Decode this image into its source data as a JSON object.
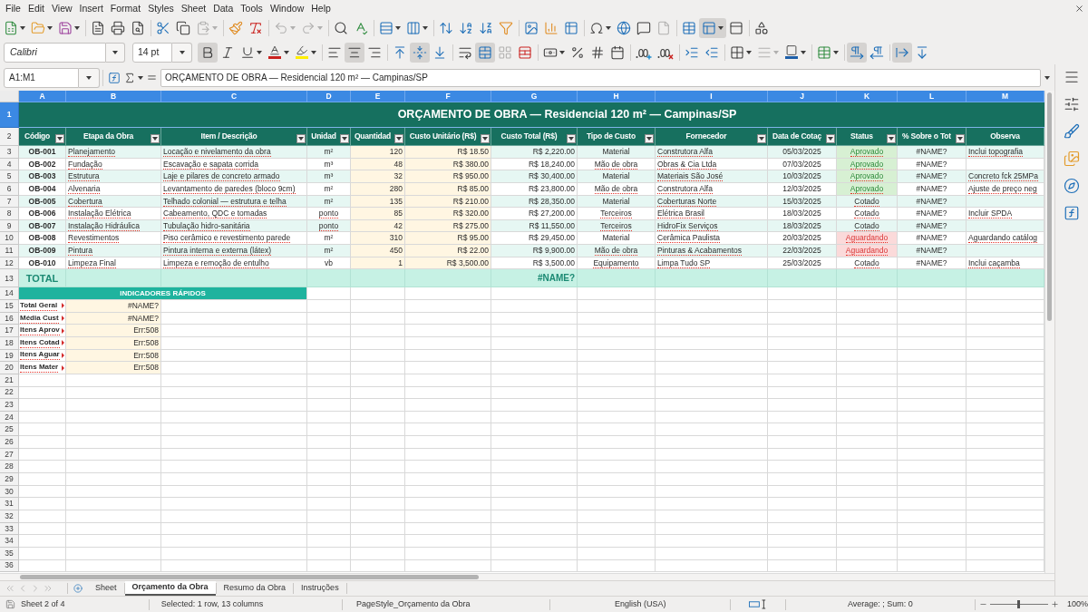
{
  "menu_bar": {
    "items": [
      "File",
      "Edit",
      "View",
      "Insert",
      "Format",
      "Styles",
      "Sheet",
      "Data",
      "Tools",
      "Window",
      "Help"
    ]
  },
  "standard_toolbar": {
    "paste_disabled": true,
    "undo_disabled": true,
    "redo_disabled": true,
    "headers_footers_disabled": true,
    "freeze_pressed": true
  },
  "formatting_toolbar": {
    "font_name": "Calibri",
    "font_size": "14 pt",
    "bold": true,
    "italic": false,
    "underline": false,
    "align_left": false,
    "align_center": true,
    "align_right": false,
    "align_top": false,
    "align_middle": true,
    "align_bottom": false,
    "merge_center": true,
    "merge_cells_disabled": true,
    "border_style_disabled": true,
    "paragraph_ltr": true,
    "paragraph_rtl": false,
    "text_horizontal": true,
    "text_vertical": false
  },
  "formula_bar": {
    "name_box": "A1:M1",
    "formula": "ORÇAMENTO DE OBRA — Residencial 120 m² — Campinas/SP"
  },
  "sheet": {
    "column_headers": [
      {
        "label": "A",
        "selected": true
      },
      {
        "label": "B",
        "selected": true
      },
      {
        "label": "C",
        "selected": true
      },
      {
        "label": "D",
        "selected": true
      },
      {
        "label": "E",
        "selected": true
      },
      {
        "label": "F",
        "selected": true
      },
      {
        "label": "G",
        "selected": true
      },
      {
        "label": "H",
        "selected": true
      },
      {
        "label": "I",
        "selected": true
      },
      {
        "label": "J",
        "selected": true
      },
      {
        "label": "K",
        "selected": true
      },
      {
        "label": "L",
        "selected": true
      },
      {
        "label": "M",
        "selected": true
      }
    ],
    "row_headers": [
      {
        "label": "1",
        "selected": true
      },
      {
        "label": "2",
        "selected": false
      },
      {
        "label": "3",
        "selected": false
      },
      {
        "label": "4",
        "selected": false
      },
      {
        "label": "5",
        "selected": false
      },
      {
        "label": "6",
        "selected": false
      },
      {
        "label": "7",
        "selected": false
      },
      {
        "label": "8",
        "selected": false
      },
      {
        "label": "9",
        "selected": false
      },
      {
        "label": "10",
        "selected": false
      },
      {
        "label": "11",
        "selected": false
      },
      {
        "label": "12",
        "selected": false
      },
      {
        "label": "13",
        "selected": false
      },
      {
        "label": "14",
        "selected": false
      },
      {
        "label": "15",
        "selected": false
      },
      {
        "label": "16",
        "selected": false
      },
      {
        "label": "17",
        "selected": false
      },
      {
        "label": "18",
        "selected": false
      },
      {
        "label": "19",
        "selected": false
      },
      {
        "label": "20",
        "selected": false
      },
      {
        "label": "21",
        "selected": false
      },
      {
        "label": "22",
        "selected": false
      },
      {
        "label": "23",
        "selected": false
      },
      {
        "label": "24",
        "selected": false
      },
      {
        "label": "25",
        "selected": false
      },
      {
        "label": "26",
        "selected": false
      },
      {
        "label": "27",
        "selected": false
      },
      {
        "label": "28",
        "selected": false
      },
      {
        "label": "29",
        "selected": false
      },
      {
        "label": "30",
        "selected": false
      },
      {
        "label": "31",
        "selected": false
      },
      {
        "label": "32",
        "selected": false
      },
      {
        "label": "33",
        "selected": false
      },
      {
        "label": "34",
        "selected": false
      },
      {
        "label": "35",
        "selected": false
      },
      {
        "label": "36",
        "selected": false
      }
    ],
    "title": "ORÇAMENTO DE OBRA — Residencial 120 m² — Campinas/SP",
    "columns": [
      {
        "label": "Código",
        "filter": true
      },
      {
        "label": "Etapa da Obra",
        "filter": true
      },
      {
        "label": "Item / Descrição",
        "filter": true
      },
      {
        "label": "Unidad",
        "filter": true
      },
      {
        "label": "Quantidad",
        "filter": true
      },
      {
        "label": "Custo Unitário (R$)",
        "filter": true
      },
      {
        "label": "Custo Total (R$)",
        "filter": true
      },
      {
        "label": "Tipo de Custo",
        "filter": true
      },
      {
        "label": "Fornecedor",
        "filter": true
      },
      {
        "label": "Data de Cotaç",
        "filter": true
      },
      {
        "label": "Status",
        "filter": true
      },
      {
        "label": "% Sobre o Tot",
        "filter": true
      },
      {
        "label": "Observa",
        "filter": false
      }
    ],
    "rows": [
      {
        "cells": [
          {
            "text": "OB-001",
            "spell_error": false
          },
          {
            "text": "Planejamento",
            "spell_error": true
          },
          {
            "text": "Locação e nivelamento da obra",
            "spell_error": true
          },
          {
            "text": "m²",
            "spell_error": false
          },
          {
            "text": "120",
            "spell_error": false
          },
          {
            "text": "R$ 18.50",
            "spell_error": false
          },
          {
            "text": "R$ 2,220.00",
            "spell_error": false
          },
          {
            "text": "Material",
            "spell_error": false
          },
          {
            "text": "Construtora Alfa",
            "spell_error": true
          },
          {
            "text": "05/03/2025",
            "spell_error": false
          },
          {
            "text": "Aprovado",
            "spell_error": true,
            "kind": "approved"
          },
          {
            "text": "#NAME?",
            "spell_error": false
          },
          {
            "text": "Inclui topografia",
            "spell_error": true
          }
        ]
      },
      {
        "cells": [
          {
            "text": "OB-002",
            "spell_error": false
          },
          {
            "text": "Fundação",
            "spell_error": true
          },
          {
            "text": "Escavação e sapata corrida",
            "spell_error": true
          },
          {
            "text": "m³",
            "spell_error": false
          },
          {
            "text": "48",
            "spell_error": false
          },
          {
            "text": "R$ 380.00",
            "spell_error": false
          },
          {
            "text": "R$ 18,240.00",
            "spell_error": false
          },
          {
            "text": "Mão de obra",
            "spell_error": true
          },
          {
            "text": "Obras & Cia Ltda",
            "spell_error": true
          },
          {
            "text": "07/03/2025",
            "spell_error": false
          },
          {
            "text": "Aprovado",
            "spell_error": true,
            "kind": "approved"
          },
          {
            "text": "#NAME?",
            "spell_error": false
          }
        ]
      },
      {
        "cells": [
          {
            "text": "OB-003",
            "spell_error": false
          },
          {
            "text": "Estrutura",
            "spell_error": true
          },
          {
            "text": "Laje e pilares de concreto armado",
            "spell_error": true
          },
          {
            "text": "m³",
            "spell_error": false
          },
          {
            "text": "32",
            "spell_error": false
          },
          {
            "text": "R$ 950.00",
            "spell_error": false
          },
          {
            "text": "R$ 30,400.00",
            "spell_error": false
          },
          {
            "text": "Material",
            "spell_error": false
          },
          {
            "text": "Materiais São José",
            "spell_error": true
          },
          {
            "text": "10/03/2025",
            "spell_error": false
          },
          {
            "text": "Aprovado",
            "spell_error": true,
            "kind": "approved"
          },
          {
            "text": "#NAME?",
            "spell_error": false
          },
          {
            "text": "Concreto fck 25MPa",
            "spell_error": true
          }
        ]
      },
      {
        "cells": [
          {
            "text": "OB-004",
            "spell_error": false
          },
          {
            "text": "Alvenaria",
            "spell_error": true
          },
          {
            "text": "Levantamento de paredes (bloco 9cm)",
            "spell_error": true
          },
          {
            "text": "m²",
            "spell_error": false
          },
          {
            "text": "280",
            "spell_error": false
          },
          {
            "text": "R$ 85.00",
            "spell_error": false
          },
          {
            "text": "R$ 23,800.00",
            "spell_error": false
          },
          {
            "text": "Mão de obra",
            "spell_error": true
          },
          {
            "text": "Construtora Alfa",
            "spell_error": true
          },
          {
            "text": "12/03/2025",
            "spell_error": false
          },
          {
            "text": "Aprovado",
            "spell_error": true,
            "kind": "approved"
          },
          {
            "text": "#NAME?",
            "spell_error": false
          },
          {
            "text": "Ajuste de preço neg",
            "spell_error": true
          }
        ]
      },
      {
        "cells": [
          {
            "text": "OB-005",
            "spell_error": false
          },
          {
            "text": "Cobertura",
            "spell_error": true
          },
          {
            "text": "Telhado colonial — estrutura e telha",
            "spell_error": true
          },
          {
            "text": "m²",
            "spell_error": false
          },
          {
            "text": "135",
            "spell_error": false
          },
          {
            "text": "R$ 210.00",
            "spell_error": false
          },
          {
            "text": "R$ 28,350.00",
            "spell_error": false
          },
          {
            "text": "Material",
            "spell_error": false
          },
          {
            "text": "Coberturas Norte",
            "spell_error": true
          },
          {
            "text": "15/03/2025",
            "spell_error": false
          },
          {
            "text": "Cotado",
            "spell_error": true,
            "kind": "quoted"
          },
          {
            "text": "#NAME?",
            "spell_error": false
          }
        ]
      },
      {
        "cells": [
          {
            "text": "OB-006",
            "spell_error": false
          },
          {
            "text": "Instalação Elétrica",
            "spell_error": true
          },
          {
            "text": "Cabeamento, QDC e tomadas",
            "spell_error": true
          },
          {
            "text": "ponto",
            "spell_error": true
          },
          {
            "text": "85",
            "spell_error": false
          },
          {
            "text": "R$ 320.00",
            "spell_error": false
          },
          {
            "text": "R$ 27,200.00",
            "spell_error": false
          },
          {
            "text": "Terceiros",
            "spell_error": true
          },
          {
            "text": "Elétrica Brasil",
            "spell_error": true
          },
          {
            "text": "18/03/2025",
            "spell_error": false
          },
          {
            "text": "Cotado",
            "spell_error": true,
            "kind": "quoted"
          },
          {
            "text": "#NAME?",
            "spell_error": false
          },
          {
            "text": "Incluir SPDA",
            "spell_error": true
          }
        ]
      },
      {
        "cells": [
          {
            "text": "OB-007",
            "spell_error": false
          },
          {
            "text": "Instalação Hidráulica",
            "spell_error": true
          },
          {
            "text": "Tubulação hidro-sanitária",
            "spell_error": true
          },
          {
            "text": "ponto",
            "spell_error": true
          },
          {
            "text": "42",
            "spell_error": false
          },
          {
            "text": "R$ 275.00",
            "spell_error": false
          },
          {
            "text": "R$ 11,550.00",
            "spell_error": false
          },
          {
            "text": "Terceiros",
            "spell_error": true
          },
          {
            "text": "HidroFix Serviços",
            "spell_error": true
          },
          {
            "text": "18/03/2025",
            "spell_error": false
          },
          {
            "text": "Cotado",
            "spell_error": true,
            "kind": "quoted"
          },
          {
            "text": "#NAME?",
            "spell_error": false
          }
        ]
      },
      {
        "cells": [
          {
            "text": "OB-008",
            "spell_error": false
          },
          {
            "text": "Revestimentos",
            "spell_error": true
          },
          {
            "text": "Piso cerâmico e revestimento parede",
            "spell_error": true
          },
          {
            "text": "m²",
            "spell_error": false
          },
          {
            "text": "310",
            "spell_error": false
          },
          {
            "text": "R$ 95.00",
            "spell_error": false
          },
          {
            "text": "R$ 29,450.00",
            "spell_error": false
          },
          {
            "text": "Material",
            "spell_error": false
          },
          {
            "text": "Cerâmica Paulista",
            "spell_error": true
          },
          {
            "text": "20/03/2025",
            "spell_error": false
          },
          {
            "text": "Aguardando",
            "spell_error": true,
            "kind": "waiting"
          },
          {
            "text": "#NAME?",
            "spell_error": false
          },
          {
            "text": "Aguardando catálog",
            "spell_error": true
          }
        ]
      },
      {
        "cells": [
          {
            "text": "OB-009",
            "spell_error": false
          },
          {
            "text": "Pintura",
            "spell_error": true
          },
          {
            "text": "Pintura interna e externa (látex)",
            "spell_error": true
          },
          {
            "text": "m²",
            "spell_error": false
          },
          {
            "text": "450",
            "spell_error": false
          },
          {
            "text": "R$ 22.00",
            "spell_error": false
          },
          {
            "text": "R$ 9,900.00",
            "spell_error": false
          },
          {
            "text": "Mão de obra",
            "spell_error": true
          },
          {
            "text": "Pinturas & Acabamentos",
            "spell_error": true
          },
          {
            "text": "22/03/2025",
            "spell_error": false
          },
          {
            "text": "Aguardando",
            "spell_error": true,
            "kind": "waiting"
          },
          {
            "text": "#NAME?",
            "spell_error": false
          }
        ]
      },
      {
        "cells": [
          {
            "text": "OB-010",
            "spell_error": false
          },
          {
            "text": "Limpeza Final",
            "spell_error": true
          },
          {
            "text": "Limpeza e remoção de entulho",
            "spell_error": true
          },
          {
            "text": "vb",
            "spell_error": false
          },
          {
            "text": "1",
            "spell_error": false
          },
          {
            "text": "R$ 3,500.00",
            "spell_error": false
          },
          {
            "text": "R$ 3,500.00",
            "spell_error": false
          },
          {
            "text": "Equipamento",
            "spell_error": true
          },
          {
            "text": "Limpa Tudo SP",
            "spell_error": true
          },
          {
            "text": "25/03/2025",
            "spell_error": false
          },
          {
            "text": "Cotado",
            "spell_error": true,
            "kind": "quoted"
          },
          {
            "text": "#NAME?",
            "spell_error": false
          },
          {
            "text": "Inclui caçamba",
            "spell_error": true
          }
        ]
      }
    ],
    "total": {
      "label": "TOTAL",
      "value": "#NAME?"
    },
    "indicators": {
      "title": "INDICADORES RÁPIDOS",
      "items": [
        {
          "label": "Total Geral",
          "value": "#NAME?",
          "truncated": true,
          "spell_error": true
        },
        {
          "label": "Média Cust",
          "value": "#NAME?",
          "truncated": true,
          "spell_error": true
        },
        {
          "label": "Itens Aprov",
          "value": "Err:508",
          "truncated": true,
          "spell_error": true
        },
        {
          "label": "Itens Cotad",
          "value": "Err:508",
          "truncated": true,
          "spell_error": true
        },
        {
          "label": "Itens Aguar",
          "value": "Err:508",
          "truncated": true,
          "spell_error": true
        },
        {
          "label": "Itens Mater",
          "value": "Err:508",
          "truncated": true,
          "spell_error": true
        }
      ]
    }
  },
  "sheet_tabs": [
    {
      "label": "Sheet",
      "selected": false
    },
    {
      "label": "Orçamento da Obra",
      "selected": true
    },
    {
      "label": "Resumo da Obra",
      "selected": false
    },
    {
      "label": "Instruções",
      "selected": false
    }
  ],
  "status_bar": {
    "sheet_position": "Sheet 2 of 4",
    "selection": "Selected: 1 row, 13 columns",
    "page_style": "PageStyle_Orçamento da Obra",
    "language": "English (USA)",
    "summary": "Average: ; Sum: 0",
    "zoom_slider": {
      "level": 0.5
    },
    "zoom": "100%"
  }
}
